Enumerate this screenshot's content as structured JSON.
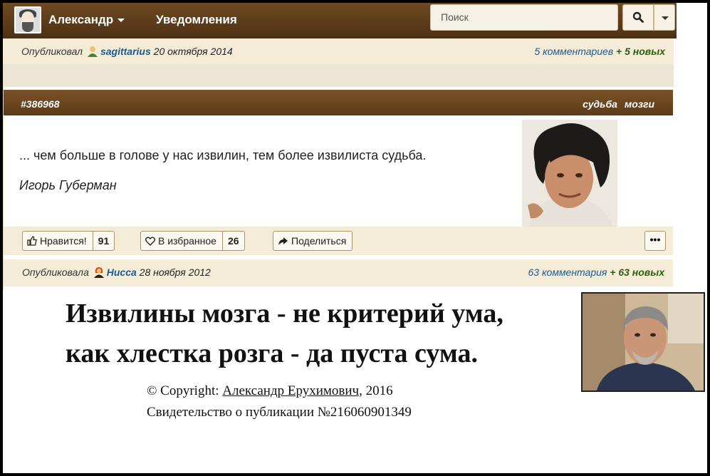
{
  "navbar": {
    "user_label": "Александр",
    "notifications_label": "Уведомления",
    "search_placeholder": "Поиск"
  },
  "post1_footer": {
    "published_label": "Опубликовал",
    "author": "sagittarius",
    "date": "20 октября 2014",
    "comments": "5 комментариев",
    "new_count": "+ 5 новых"
  },
  "card": {
    "id": "#386968",
    "tags": [
      "судьба",
      "мозги"
    ],
    "quote": "... чем больше в голове у нас извилин, тем более извилиста судьба.",
    "author": "Игорь Губерман",
    "like_label": "Нравится!",
    "like_count": "91",
    "fav_label": "В избранное",
    "fav_count": "26",
    "share_label": "Поделиться",
    "more_label": "•••"
  },
  "post2_footer": {
    "published_label": "Опубликовала",
    "author": "Нисса",
    "date": "28 ноября 2012",
    "comments": "63 комментария",
    "new_count": "+ 63 новых"
  },
  "poem": {
    "line1": "Извилины мозга - не критерий ума,",
    "line2": "как хлестка розга - да пуста сума."
  },
  "copyright": {
    "prefix": "© Copyright: ",
    "author": "Александр Ерухимович",
    "year": ", 2016",
    "certificate": "Свидетельство о публикации №216060901349"
  },
  "colors": {
    "navbar": "#5c3a17",
    "strip": "#f4ecd6",
    "link": "#1e5a8c",
    "new_green": "#2e5e12"
  }
}
